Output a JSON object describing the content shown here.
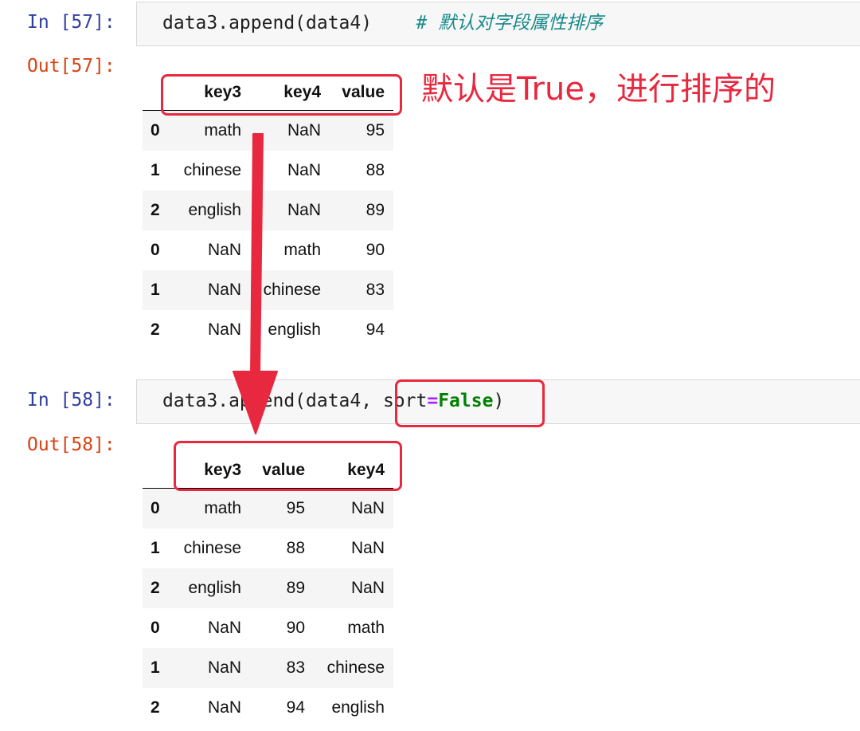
{
  "cell57": {
    "in_prompt": "In [57]:",
    "out_prompt": "Out[57]:",
    "code": "data3.append(data4)",
    "comment": "# 默认对字段属性排序"
  },
  "annotation": "默认是True，进行排序的",
  "df57": {
    "columns": [
      "key3",
      "key4",
      "value"
    ],
    "rows": [
      {
        "idx": "0",
        "c1": "math",
        "c2": "NaN",
        "c3": "95"
      },
      {
        "idx": "1",
        "c1": "chinese",
        "c2": "NaN",
        "c3": "88"
      },
      {
        "idx": "2",
        "c1": "english",
        "c2": "NaN",
        "c3": "89"
      },
      {
        "idx": "0",
        "c1": "NaN",
        "c2": "math",
        "c3": "90"
      },
      {
        "idx": "1",
        "c1": "NaN",
        "c2": "chinese",
        "c3": "83"
      },
      {
        "idx": "2",
        "c1": "NaN",
        "c2": "english",
        "c3": "94"
      }
    ]
  },
  "cell58": {
    "in_prompt": "In [58]:",
    "out_prompt": "Out[58]:",
    "code_pre": "data3.append(data4, ",
    "code_arg": "sort",
    "code_op": "=",
    "code_kw": "False",
    "code_post": ")"
  },
  "df58": {
    "columns": [
      "key3",
      "value",
      "key4"
    ],
    "rows": [
      {
        "idx": "0",
        "c1": "math",
        "c2": "95",
        "c3": "NaN"
      },
      {
        "idx": "1",
        "c1": "chinese",
        "c2": "88",
        "c3": "NaN"
      },
      {
        "idx": "2",
        "c1": "english",
        "c2": "89",
        "c3": "NaN"
      },
      {
        "idx": "0",
        "c1": "NaN",
        "c2": "90",
        "c3": "math"
      },
      {
        "idx": "1",
        "c1": "NaN",
        "c2": "83",
        "c3": "chinese"
      },
      {
        "idx": "2",
        "c1": "NaN",
        "c2": "94",
        "c3": "english"
      }
    ]
  },
  "colors": {
    "annotation_red": "#e8283f",
    "in_prompt": "#303f9f",
    "out_prompt": "#d84315"
  }
}
